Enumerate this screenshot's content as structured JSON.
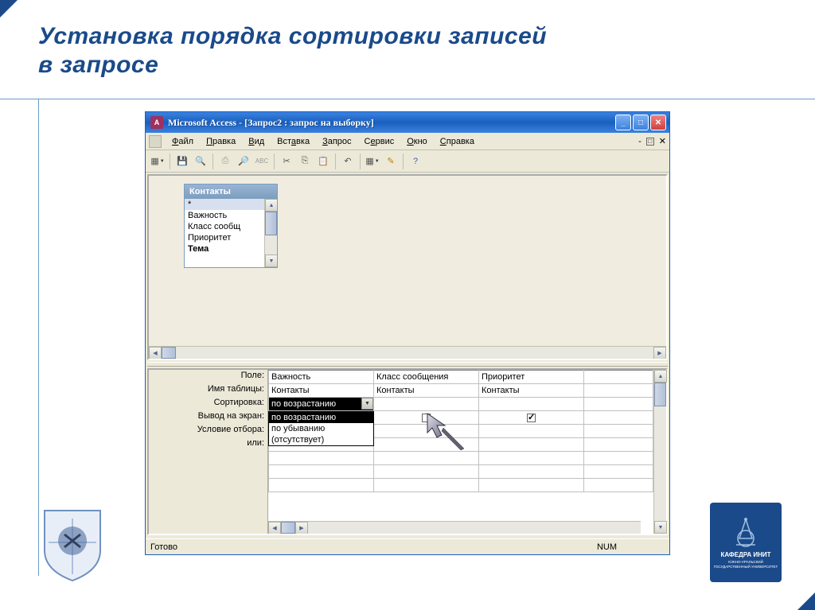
{
  "slide": {
    "title_line1": "Установка порядка сортировки записей",
    "title_line2": "в запросе"
  },
  "window": {
    "title": "Microsoft Access - [Запрос2 : запрос на выборку]",
    "menus": [
      "Файл",
      "Правка",
      "Вид",
      "Вставка",
      "Запрос",
      "Сервис",
      "Окно",
      "Справка"
    ],
    "table_panel": {
      "title": "Контакты",
      "fields": [
        "*",
        "Важность",
        "Класс сообщения",
        "Приоритет",
        "Тема"
      ]
    },
    "grid": {
      "row_labels": [
        "Поле:",
        "Имя таблицы:",
        "Сортировка:",
        "Вывод на экран:",
        "Условие отбора:",
        "или:"
      ],
      "columns": [
        {
          "field": "Важность",
          "table": "Контакты",
          "sort": "по возрастанию",
          "show": false
        },
        {
          "field": "Класс сообщения",
          "table": "Контакты",
          "sort": "",
          "show": false
        },
        {
          "field": "Приоритет",
          "table": "Контакты",
          "sort": "",
          "show": true
        }
      ],
      "sort_dropdown": {
        "selected": "по возрастанию",
        "options": [
          "по возрастанию",
          "по убыванию",
          "(отсутствует)"
        ]
      }
    },
    "status": {
      "left": "Готово",
      "right": "NUM"
    }
  },
  "logo_right": {
    "label": "КАФЕДРА ИНИТ",
    "sub": "ЮЖНО-УРАЛЬСКИЙ ГОСУДАРСТВЕННЫЙ УНИВЕРСИТЕТ"
  }
}
